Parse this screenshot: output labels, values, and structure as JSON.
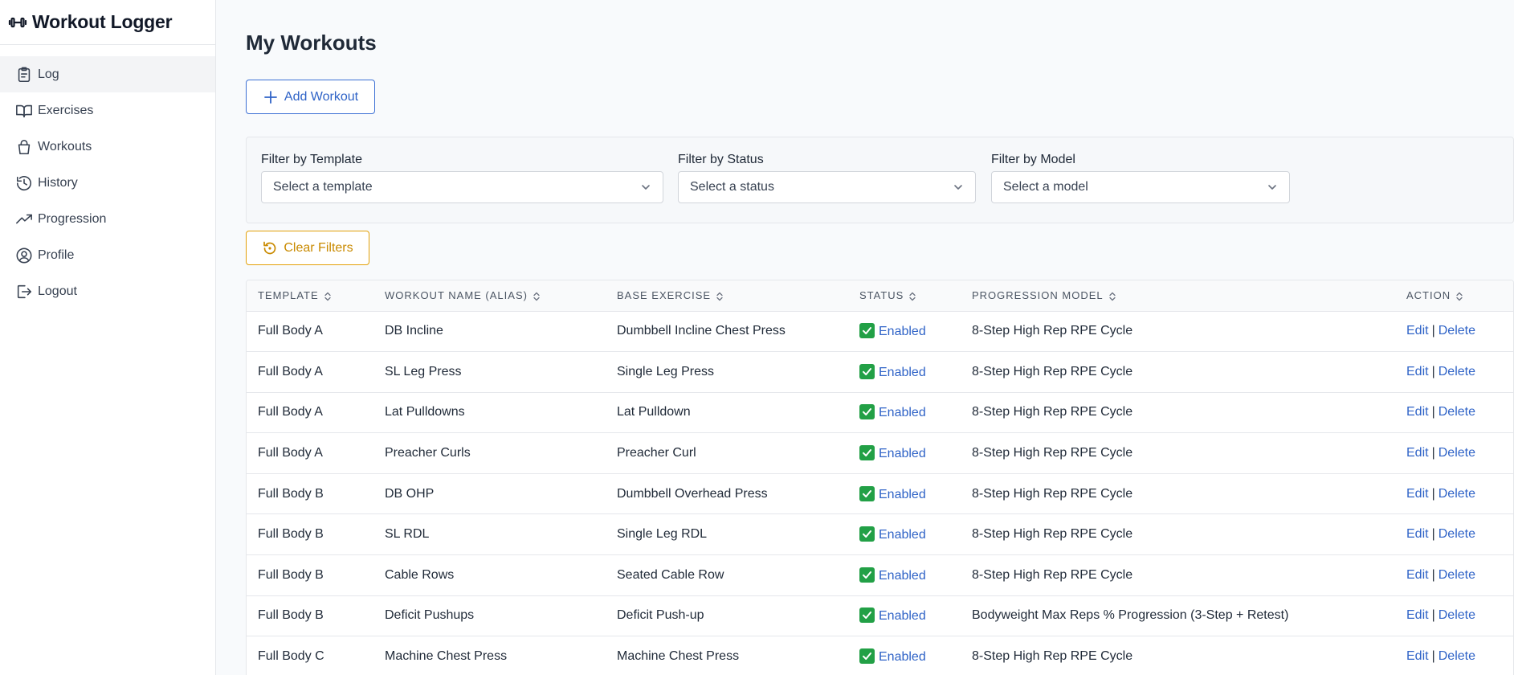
{
  "app": {
    "title": "Workout Logger"
  },
  "sidebar": {
    "items": [
      {
        "label": "Log",
        "icon": "clipboard-icon",
        "active": true
      },
      {
        "label": "Exercises",
        "icon": "book-icon"
      },
      {
        "label": "Workouts",
        "icon": "bag-icon"
      },
      {
        "label": "History",
        "icon": "history-icon"
      },
      {
        "label": "Progression",
        "icon": "trend-up-icon"
      },
      {
        "label": "Profile",
        "icon": "user-circle-icon"
      },
      {
        "label": "Logout",
        "icon": "logout-icon"
      }
    ]
  },
  "main": {
    "title": "My Workouts",
    "add_label": "Add Workout",
    "clear_label": "Clear Filters",
    "filters": {
      "template": {
        "label": "Filter by Template",
        "placeholder": "Select a template"
      },
      "status": {
        "label": "Filter by Status",
        "placeholder": "Select a status"
      },
      "model": {
        "label": "Filter by Model",
        "placeholder": "Select a model"
      }
    },
    "columns": [
      "TEMPLATE",
      "WORKOUT NAME (ALIAS)",
      "BASE EXERCISE",
      "STATUS",
      "PROGRESSION MODEL",
      "ACTION"
    ],
    "edit_label": "Edit",
    "delete_label": "Delete",
    "separator": "|",
    "rows": [
      {
        "template": "Full Body A",
        "name": "DB Incline",
        "exercise": "Dumbbell Incline Chest Press",
        "status": "Enabled",
        "model": "8-Step High Rep RPE Cycle"
      },
      {
        "template": "Full Body A",
        "name": "SL Leg Press",
        "exercise": "Single Leg Press",
        "status": "Enabled",
        "model": "8-Step High Rep RPE Cycle"
      },
      {
        "template": "Full Body A",
        "name": "Lat Pulldowns",
        "exercise": "Lat Pulldown",
        "status": "Enabled",
        "model": "8-Step High Rep RPE Cycle"
      },
      {
        "template": "Full Body A",
        "name": "Preacher Curls",
        "exercise": "Preacher Curl",
        "status": "Enabled",
        "model": "8-Step High Rep RPE Cycle"
      },
      {
        "template": "Full Body B",
        "name": "DB OHP",
        "exercise": "Dumbbell Overhead Press",
        "status": "Enabled",
        "model": "8-Step High Rep RPE Cycle"
      },
      {
        "template": "Full Body B",
        "name": "SL RDL",
        "exercise": "Single Leg RDL",
        "status": "Enabled",
        "model": "8-Step High Rep RPE Cycle"
      },
      {
        "template": "Full Body B",
        "name": "Cable Rows",
        "exercise": "Seated Cable Row",
        "status": "Enabled",
        "model": "8-Step High Rep RPE Cycle"
      },
      {
        "template": "Full Body B",
        "name": "Deficit Pushups",
        "exercise": "Deficit Push-up",
        "status": "Enabled",
        "model": "Bodyweight Max Reps % Progression (3-Step + Retest)"
      },
      {
        "template": "Full Body C",
        "name": "Machine Chest Press",
        "exercise": "Machine Chest Press",
        "status": "Enabled",
        "model": "8-Step High Rep RPE Cycle"
      }
    ]
  }
}
